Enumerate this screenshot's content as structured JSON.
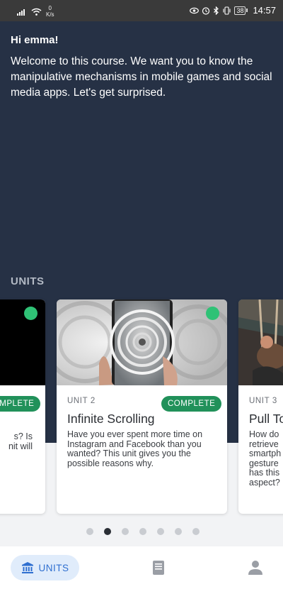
{
  "status_bar": {
    "speed_value": "0",
    "speed_unit": "K/s",
    "battery": "38",
    "time": "14:57",
    "icons": [
      "signal-icon",
      "wifi-icon",
      "eye-icon",
      "alarm-icon",
      "bluetooth-icon",
      "vibrate-icon",
      "battery-icon"
    ]
  },
  "header": {
    "greeting": "Hi emma!",
    "welcome_text": "Welcome to this course. We want you to know the manipulative mechanisms in mobile games and social media apps. Let's get surprised."
  },
  "units_section": {
    "heading": "UNITS",
    "cards": [
      {
        "unit_label": "",
        "badge": "COMPLETE",
        "description_lines": [
          "s? Is",
          "nit will"
        ],
        "completed": true,
        "image": "black-placeholder"
      },
      {
        "unit_label": "UNIT 2",
        "title": "Infinite Scrolling",
        "badge": "COMPLETE",
        "description": "Have you ever spent more time on Instagram and Facebook than you wanted? This unit gives you the possible reasons why.",
        "completed": true,
        "image": "spiral-staircase-phone-photo"
      },
      {
        "unit_label": "UNIT 3",
        "title": "Pull To",
        "description_lines": [
          "How do",
          "retrieve",
          "smartph",
          "gesture",
          "has this",
          "aspect?"
        ],
        "image": "person-on-swing-photo"
      }
    ]
  },
  "pager": {
    "count": 7,
    "active_index": 1
  },
  "bottom_nav": {
    "units_label": "UNITS",
    "units_icon": "bank-icon",
    "book_icon": "book-icon",
    "profile_icon": "person-icon"
  },
  "colors": {
    "hero_bg": "#263145",
    "accent_green": "#2fc276",
    "badge_green": "#21915a",
    "nav_active_bg": "#e0ecfb",
    "nav_active_text": "#2f6fd0"
  }
}
